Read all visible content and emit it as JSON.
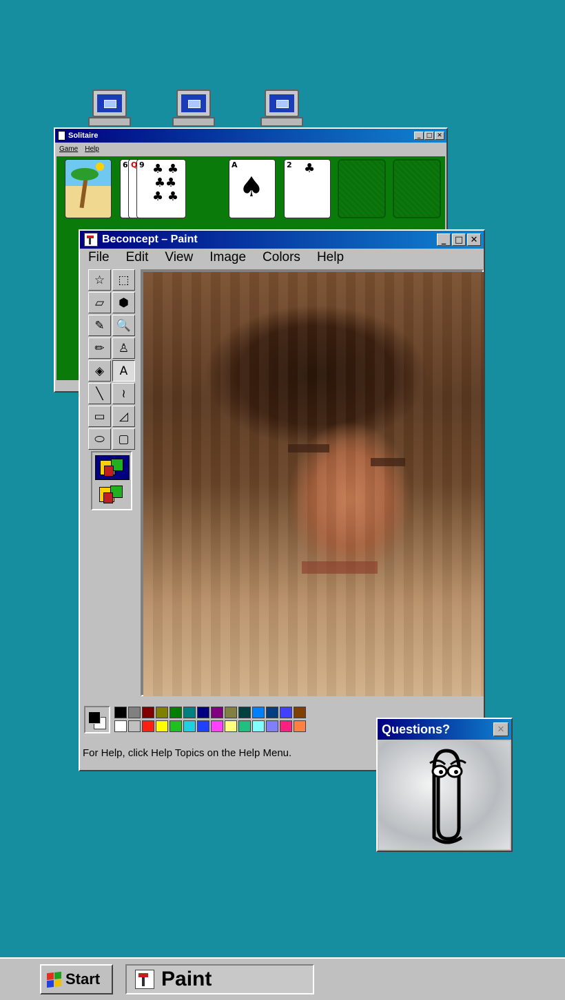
{
  "desktop": {
    "background": "#178e9f",
    "icons": [
      "computer-icon",
      "computer-icon",
      "computer-icon"
    ]
  },
  "solitaire": {
    "title": "Solitaire",
    "menu": [
      "Game",
      "Help"
    ],
    "stock_cards": [
      {
        "rank": "6",
        "suit": "♣"
      },
      {
        "rank": "Q",
        "suit": "♥"
      },
      {
        "rank": "9",
        "suit": "♣"
      }
    ],
    "foundation_cards": [
      {
        "rank": "A",
        "suit": "♠"
      },
      {
        "rank": "2",
        "suit": "♣"
      }
    ]
  },
  "paint": {
    "title": "Beconcept – Paint",
    "menu": [
      "File",
      "Edit",
      "View",
      "Image",
      "Colors",
      "Help"
    ],
    "tools": [
      "free-select-icon",
      "rect-select-icon",
      "eraser-icon",
      "fill-icon",
      "picker-icon",
      "magnifier-icon",
      "pencil-icon",
      "brush-icon",
      "airbrush-icon",
      "text-icon",
      "line-icon",
      "curve-icon",
      "rectangle-icon",
      "polygon-icon",
      "ellipse-icon",
      "rounded-rect-icon"
    ],
    "tool_glyphs": [
      "☆",
      "⬚",
      "▱",
      "⬢",
      "✎",
      "🔍",
      "✏",
      "♙",
      "◈",
      "A",
      "╲",
      "≀",
      "▭",
      "◿",
      "⬭",
      "▢"
    ],
    "status_text": "For Help, click Help Topics on the Help Menu.",
    "palette_top": [
      "#000000",
      "#808080",
      "#800000",
      "#808000",
      "#008000",
      "#008080",
      "#000080",
      "#800080",
      "#808040",
      "#004040",
      "#0080ff",
      "#004080",
      "#4040ff",
      "#804000"
    ],
    "palette_bottom": [
      "#ffffff",
      "#c0c0c0",
      "#ff2010",
      "#ffff00",
      "#20c020",
      "#20d0e0",
      "#2040ff",
      "#ff40ff",
      "#ffff80",
      "#20c080",
      "#80ffff",
      "#8080ff",
      "#ff2080",
      "#ff8040"
    ],
    "foreground_color": "#000000",
    "background_color": "#ffffff"
  },
  "assistant": {
    "title": "Questions?",
    "close_label": "✕"
  },
  "taskbar": {
    "start_label": "Start",
    "task_label": "Paint"
  }
}
